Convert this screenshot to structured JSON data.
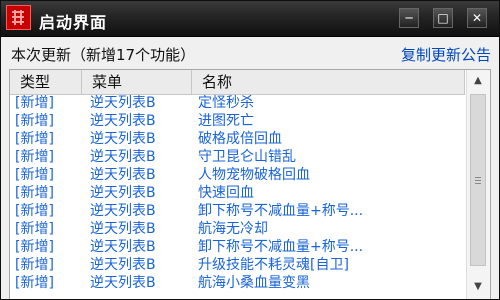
{
  "window": {
    "title": "启动界面",
    "controls": {
      "minimize": "─",
      "maximize": "□",
      "close": "✕"
    }
  },
  "header": {
    "info": "本次更新（新增17个功能）",
    "notice_link": "复制更新公告"
  },
  "list": {
    "columns": [
      "类型",
      "菜单",
      "名称"
    ],
    "rows": [
      [
        "[新增]",
        "逆天列表B",
        "定怪秒杀"
      ],
      [
        "[新增]",
        "逆天列表B",
        "进图死亡"
      ],
      [
        "[新增]",
        "逆天列表B",
        "破格成倍回血"
      ],
      [
        "[新增]",
        "逆天列表B",
        "守卫昆仑山错乱"
      ],
      [
        "[新增]",
        "逆天列表B",
        "人物宠物破格回血"
      ],
      [
        "[新增]",
        "逆天列表B",
        "快速回血"
      ],
      [
        "[新增]",
        "逆天列表B",
        "卸下称号不减血量+称号..."
      ],
      [
        "[新增]",
        "逆天列表B",
        "航海无冷却"
      ],
      [
        "[新增]",
        "逆天列表B",
        "卸下称号不减血量+称号..."
      ],
      [
        "[新增]",
        "逆天列表B",
        "升级技能不耗灵魂[自卫]"
      ],
      [
        "[新增]",
        "逆天列表B",
        "航海小桑血量变黑"
      ]
    ]
  },
  "icons": {
    "app": "app-logo-icon",
    "scroll_up": "scroll-up-icon",
    "scroll_down": "scroll-down-icon"
  },
  "colors": {
    "row_text": "#1964d8",
    "link": "#0047ba",
    "titlebar": "#242424"
  }
}
